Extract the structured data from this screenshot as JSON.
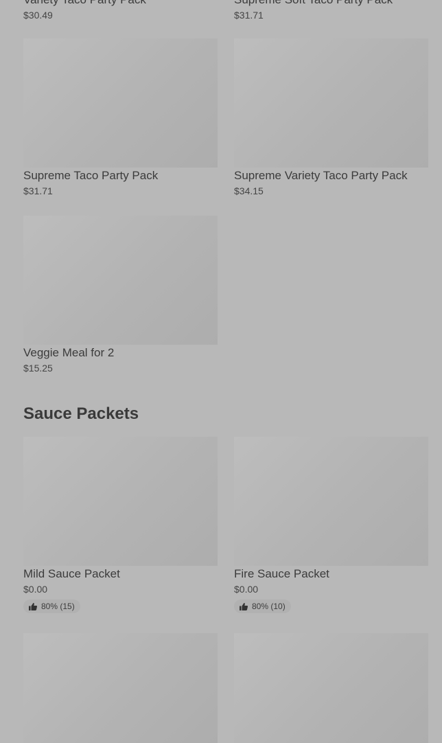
{
  "top_row": [
    {
      "name": "Variety Taco Party Pack",
      "price": "$30.49"
    },
    {
      "name": "Supreme Soft Taco Party Pack",
      "price": "$31.71"
    }
  ],
  "party_packs": [
    {
      "name": "Supreme Taco Party Pack",
      "price": "$31.71"
    },
    {
      "name": "Supreme Variety Taco Party Pack",
      "price": "$34.15"
    },
    {
      "name": "Veggie Meal for 2",
      "price": "$15.25"
    }
  ],
  "sauce_section": {
    "title": "Sauce Packets",
    "items": [
      {
        "name": "Mild Sauce Packet",
        "price": "$0.00",
        "rating": "80% (15)"
      },
      {
        "name": "Fire Sauce Packet",
        "price": "$0.00",
        "rating": "80% (10)"
      }
    ]
  },
  "icons": {
    "rating_icon": "thumbs-up-icon"
  },
  "colors": {
    "overlay_background": "#b8b8b8",
    "image_placeholder": "#b3b3b3",
    "text": "#3e3e3e"
  }
}
